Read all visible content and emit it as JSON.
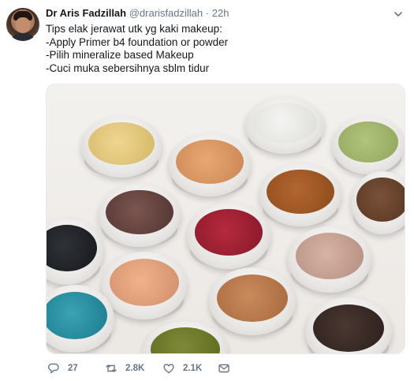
{
  "tweet": {
    "author_name": "Dr Aris Fadzillah",
    "author_handle": "@drarisfadzillah",
    "separator": "·",
    "time": "22h",
    "lines": [
      "Tips elak jerawat utk yg kaki makeup:",
      "-Apply Primer b4 foundation or powder",
      "-Pilih mineralize based Makeup",
      "-Cuci muka sebersihnya sblm tidur"
    ]
  },
  "actions": {
    "reply_count": "27",
    "retweet_count": "2.8K",
    "like_count": "2.1K"
  },
  "icons": {
    "reply": "reply-icon",
    "retweet": "retweet-icon",
    "like": "heart-icon",
    "message": "envelope-icon",
    "menu": "chevron-down-icon"
  },
  "colors": {
    "text": "#14171a",
    "muted": "#657786",
    "border": "#e6ecf0"
  }
}
